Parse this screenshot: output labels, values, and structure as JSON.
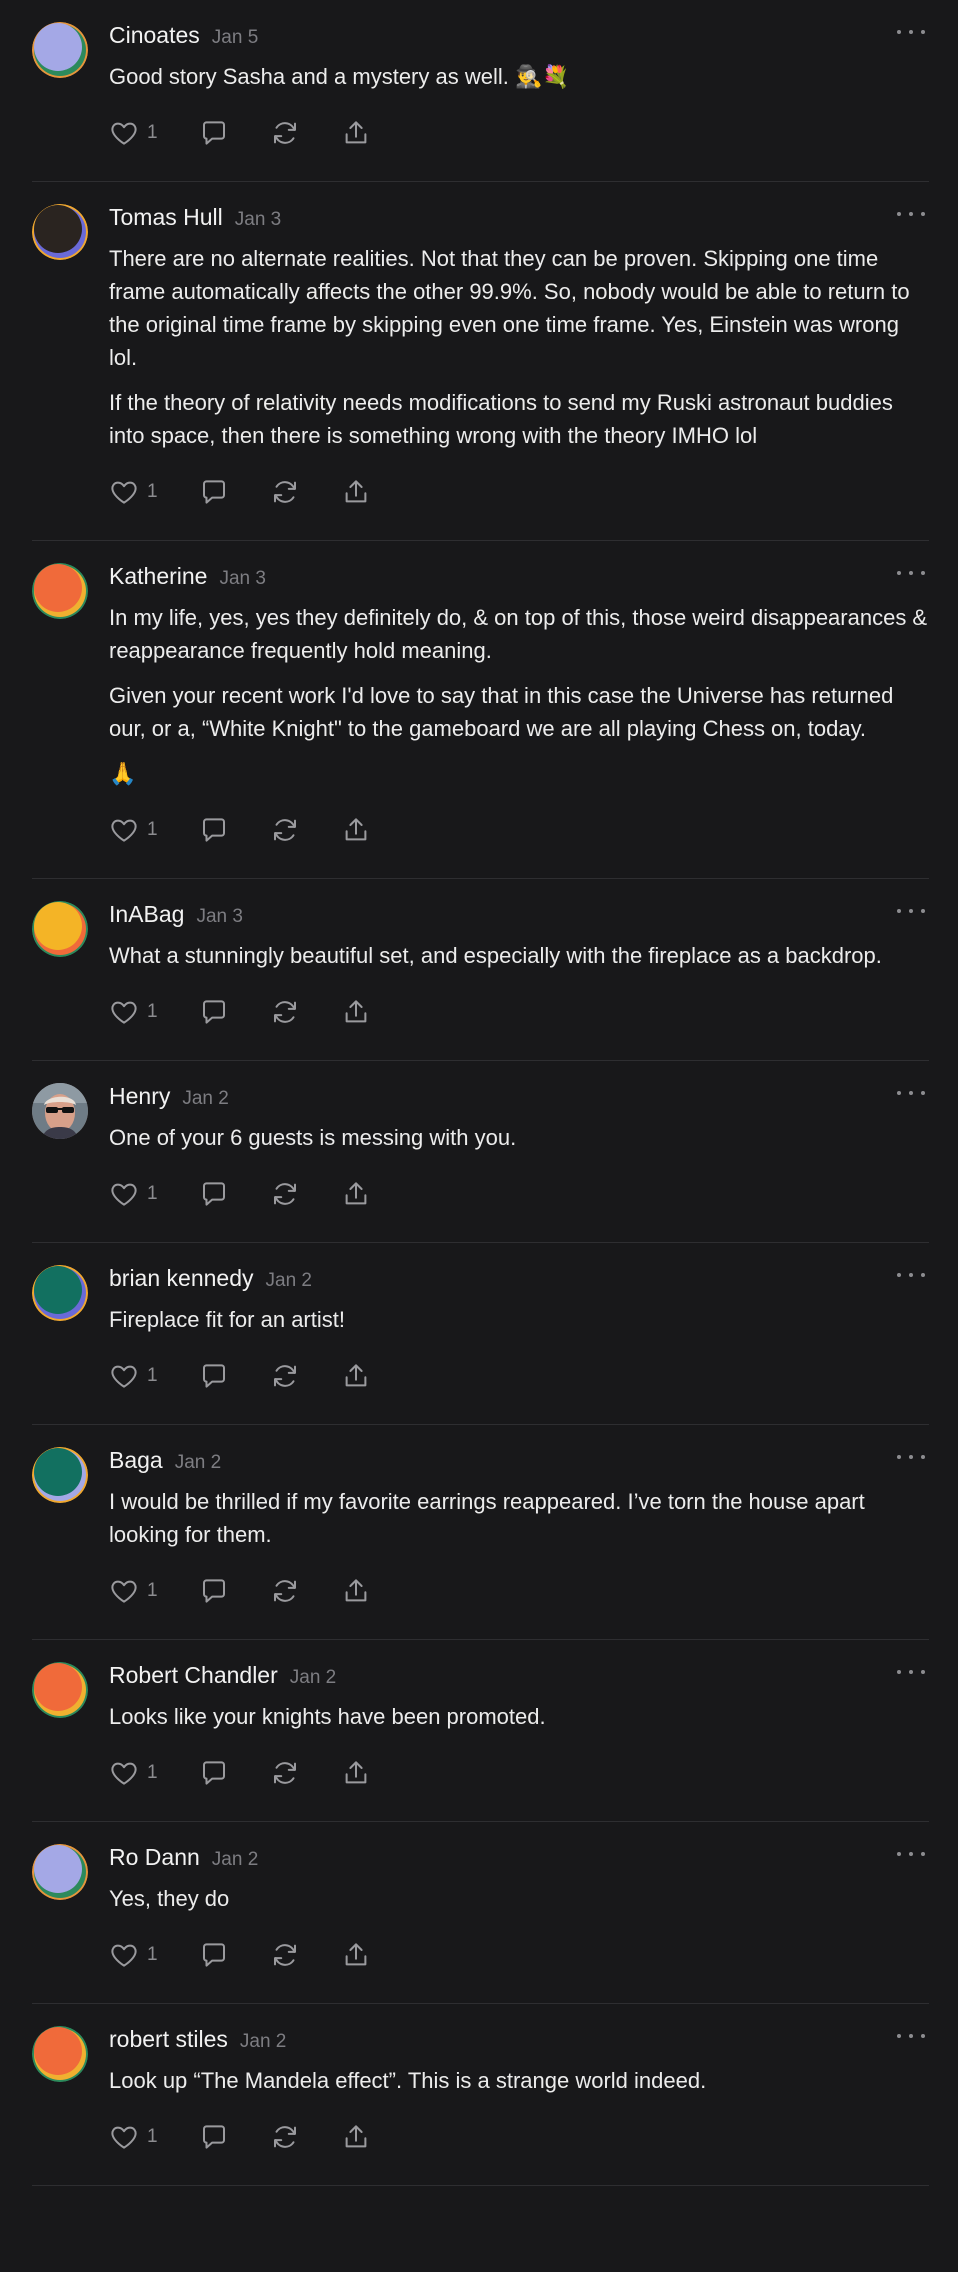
{
  "comments": [
    {
      "name": "Cinoates",
      "date": "Jan 5",
      "paragraphs": [
        "Good story Sasha and a mystery as well. 🕵️‍♂️💐"
      ],
      "likes": "1",
      "avatar": [
        "#e6963c",
        "#2c8a5c",
        "#a4a8e6"
      ]
    },
    {
      "name": "Tomas Hull",
      "date": "Jan 3",
      "paragraphs": [
        "There are no alternate realities. Not that they can be proven. Skipping one time frame automatically affects the other 99.9%. So, nobody would be able to return to the original time frame by skipping even one time frame. Yes, Einstein was wrong lol.",
        "If the theory of relativity needs modifications to send my Ruski astronaut buddies into space, then there is something wrong with the theory IMHO lol"
      ],
      "likes": "1",
      "avatar": [
        "#f0a830",
        "#6a6ad8",
        "#2a2420"
      ]
    },
    {
      "name": "Katherine",
      "date": "Jan 3",
      "paragraphs": [
        "In my life, yes, yes they definitely do, & on top of this, those weird disappearances & reappearance frequently hold meaning.",
        "Given your recent work I'd love to say that in this case the Universe has returned our, or a, “White Knight\" to the gameboard we are all playing Chess on, today.",
        "🙏"
      ],
      "likes": "1",
      "avatar": [
        "#2c8a5c",
        "#f0b030",
        "#f06a3a"
      ]
    },
    {
      "name": "InABag",
      "date": "Jan 3",
      "paragraphs": [
        "What a stunningly beautiful set, and especially with the fireplace as a backdrop."
      ],
      "likes": "1",
      "avatar": [
        "#2c8a5c",
        "#f06a3a",
        "#f4b426"
      ]
    },
    {
      "name": "Henry",
      "date": "Jan 2",
      "paragraphs": [
        "One of your 6 guests is messing with you."
      ],
      "likes": "1",
      "avatar": [
        "photo"
      ]
    },
    {
      "name": "brian kennedy",
      "date": "Jan 2",
      "paragraphs": [
        "Fireplace fit for an artist!"
      ],
      "likes": "1",
      "avatar": [
        "#f0a830",
        "#6a6ad8",
        "#127060"
      ]
    },
    {
      "name": "Baga",
      "date": "Jan 2",
      "paragraphs": [
        "I would be thrilled if my favorite earrings reappeared. I’ve torn the house apart looking for them."
      ],
      "likes": "1",
      "avatar": [
        "#f0a830",
        "#a4a8e6",
        "#127060"
      ]
    },
    {
      "name": "Robert Chandler",
      "date": "Jan 2",
      "paragraphs": [
        "Looks like your knights have been promoted."
      ],
      "likes": "1",
      "avatar": [
        "#2c8a5c",
        "#f0b030",
        "#f06a3a"
      ]
    },
    {
      "name": "Ro Dann",
      "date": "Jan 2",
      "paragraphs": [
        "Yes, they do"
      ],
      "likes": "1",
      "avatar": [
        "#e6963c",
        "#2c8a5c",
        "#a4a8e6"
      ]
    },
    {
      "name": "robert stiles",
      "date": "Jan 2",
      "paragraphs": [
        "Look up “The Mandela effect”. This is a strange world indeed."
      ],
      "likes": "1",
      "avatar": [
        "#2c8a5c",
        "#f0b030",
        "#f06a3a"
      ]
    }
  ],
  "icons": {
    "like": "heart-icon",
    "reply": "comment-icon",
    "restack": "restack-icon",
    "share": "share-icon",
    "more": "more-icon"
  }
}
